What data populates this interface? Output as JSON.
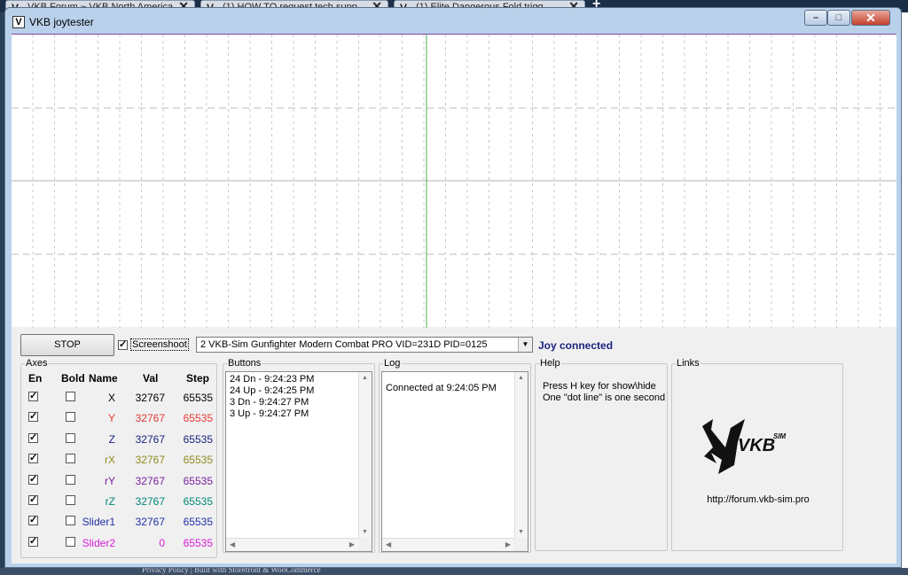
{
  "browser": {
    "tabs": [
      {
        "label": "VKB Forum ~ VKB North America"
      },
      {
        "label": "(1) HOW TO request tech supp"
      },
      {
        "label": "(1) Elite Dangerous Fold trigg"
      }
    ]
  },
  "background_page": {
    "footer_text": "Privacy Policy | Built with Storefront & WooCommerce"
  },
  "window": {
    "title": "VKB joytester",
    "controls": {
      "minimize": "–",
      "maximize": "□",
      "close": "✕"
    }
  },
  "toolbar": {
    "stop_label": "STOP",
    "screenshoot_label": "Screenshoot",
    "screenshoot_checked": true,
    "device_selected": "2  VKB-Sim Gunfighter Modern Combat PRO  VID=231D PID=0125",
    "status": "Joy connected"
  },
  "axes": {
    "title": "Axes",
    "headers": {
      "en": "En",
      "bold": "Bold",
      "name": "Name",
      "val": "Val",
      "step": "Step"
    },
    "rows": [
      {
        "name": "X",
        "val": "32767",
        "step": "65535",
        "color": "#000000",
        "en": true,
        "bold": false
      },
      {
        "name": "Y",
        "val": "32767",
        "step": "65535",
        "color": "#e53935",
        "en": true,
        "bold": false
      },
      {
        "name": "Z",
        "val": "32767",
        "step": "65535",
        "color": "#1a237e",
        "en": true,
        "bold": false
      },
      {
        "name": "rX",
        "val": "32767",
        "step": "65535",
        "color": "#8d8a1e",
        "en": true,
        "bold": false
      },
      {
        "name": "rY",
        "val": "32767",
        "step": "65535",
        "color": "#7b1fa2",
        "en": true,
        "bold": false
      },
      {
        "name": "rZ",
        "val": "32767",
        "step": "65535",
        "color": "#00897b",
        "en": true,
        "bold": false
      },
      {
        "name": "Slider1",
        "val": "32767",
        "step": "65535",
        "color": "#1f2fa8",
        "en": true,
        "bold": false
      },
      {
        "name": "Slider2",
        "val": "0",
        "step": "65535",
        "color": "#d81bd8",
        "en": true,
        "bold": false
      }
    ]
  },
  "buttons_panel": {
    "title": "Buttons",
    "items": [
      "24 Dn - 9:24:23 PM",
      "24 Up - 9:24:25 PM",
      "3 Dn - 9:24:27 PM",
      "3 Up - 9:24:27 PM"
    ]
  },
  "log_panel": {
    "title": "Log",
    "items": [
      "Connected at 9:24:05 PM"
    ]
  },
  "help_panel": {
    "title": "Help",
    "lines": [
      "Press H key for show\\hide",
      "One \"dot line\" is one second"
    ]
  },
  "links_panel": {
    "title": "Links",
    "logo_text": "VKB",
    "logo_sup": "SIM",
    "url": "http://forum.vkb-sim.pro"
  },
  "plot": {
    "center_line_color": "#4caf50"
  }
}
